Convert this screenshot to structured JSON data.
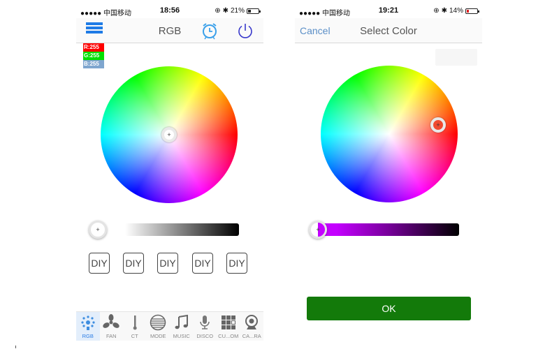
{
  "left_screen": {
    "status_bar": {
      "carrier": "●●●●● 中国移动",
      "time": "18:56",
      "battery": "21%",
      "battery_level": 0.21
    },
    "nav": {
      "title": "RGB",
      "menu_icon": "list-icon",
      "alarm_icon": "alarm-clock-icon",
      "power_icon": "power-icon"
    },
    "rgb_readout": {
      "r": "R:255",
      "g": "G:255",
      "b": "B:255"
    },
    "brightness_slider": {
      "value": 0,
      "knob_glyph": "+"
    },
    "wheel_knob_glyph": "+",
    "diy_buttons": [
      "DIY",
      "DIY",
      "DIY",
      "DIY",
      "DIY"
    ],
    "tabs": [
      {
        "label": "RGB",
        "icon": "rgb-bulb-icon",
        "active": true
      },
      {
        "label": "FAN",
        "icon": "fan-icon",
        "active": false
      },
      {
        "label": "CT",
        "icon": "thermometer-icon",
        "active": false
      },
      {
        "label": "MODE",
        "icon": "mode-disc-icon",
        "active": false
      },
      {
        "label": "MUSIC",
        "icon": "music-note-icon",
        "active": false
      },
      {
        "label": "DISCO",
        "icon": "microphone-icon",
        "active": false
      },
      {
        "label": "CU...OM",
        "icon": "grid-icon",
        "active": false
      },
      {
        "label": "CA...RA",
        "icon": "webcam-icon",
        "active": false
      }
    ]
  },
  "right_screen": {
    "status_bar": {
      "carrier": "●●●●● 中国移动",
      "time": "19:21",
      "battery": "14%",
      "battery_level": 0.14
    },
    "nav": {
      "cancel_label": "Cancel",
      "title": "Select Color"
    },
    "wheel_knob_glyph": "+",
    "selected_color": "#f04a30",
    "brightness_slider": {
      "value": 0,
      "start_color": "#c400ff",
      "end_color": "#000000",
      "knob_glyph": "+"
    },
    "ok_label": "OK"
  },
  "colors": {
    "accent_blue": "#1e7be6",
    "power_purple": "#3a3acb",
    "ok_green": "#137a0a",
    "r_bg": "#ff0000",
    "g_bg": "#00e000",
    "b_bg": "#7fa6cf"
  }
}
